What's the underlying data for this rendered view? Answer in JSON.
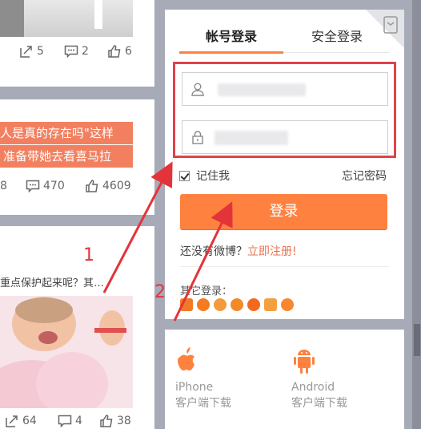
{
  "feed": {
    "card1": {
      "repost": "5",
      "comment": "2",
      "like": "6"
    },
    "card2": {
      "line1": "人是真的存在吗\"这样",
      "line2": "准备带她去看喜马拉",
      "repost": "8",
      "comment": "470",
      "like": "4609"
    },
    "card3": {
      "snippet": "重点保护起来呢？其…",
      "repost": "64",
      "comment": "4",
      "like": "38"
    }
  },
  "login": {
    "tab_account": "帐号登录",
    "tab_secure": "安全登录",
    "remember": "记住我",
    "forgot": "忘记密码",
    "login_button": "登录",
    "no_account": "还没有微博？",
    "register": "立即注册!",
    "other_login": "其它登录："
  },
  "apps": {
    "iphone_name": "iPhone",
    "iphone_sub": "客户端下载",
    "android_name": "Android",
    "android_sub": "客户端下载"
  },
  "annotations": {
    "one": "1",
    "two": "2"
  },
  "colors": {
    "accent": "#ff8140",
    "annotation": "#e1414a"
  }
}
